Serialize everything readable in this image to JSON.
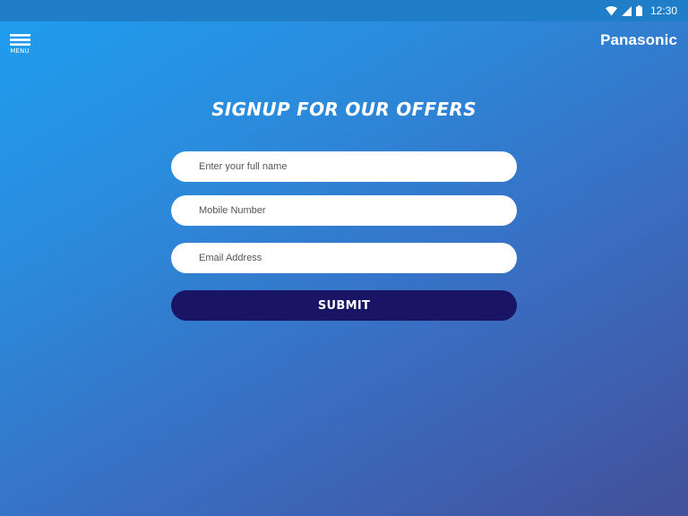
{
  "status_bar": {
    "time": "12:30",
    "icons": [
      "wifi-icon",
      "signal-icon",
      "battery-icon"
    ]
  },
  "header": {
    "menu_label": "MENU",
    "menu_icon": "hamburger-icon",
    "brand": "Panasonic"
  },
  "main": {
    "title": "SIGNUP FOR OUR OFFERS",
    "form": {
      "name_placeholder": "Enter your full name",
      "mobile_placeholder": "Mobile Number",
      "email_placeholder": "Email Address",
      "submit_label": "SUBMIT"
    }
  },
  "colors": {
    "gradient_start": "#1e9ef0",
    "gradient_end": "#43509a",
    "status_bar": "#1f7ec7",
    "submit_button": "#1a1464",
    "text": "#ffffff"
  }
}
